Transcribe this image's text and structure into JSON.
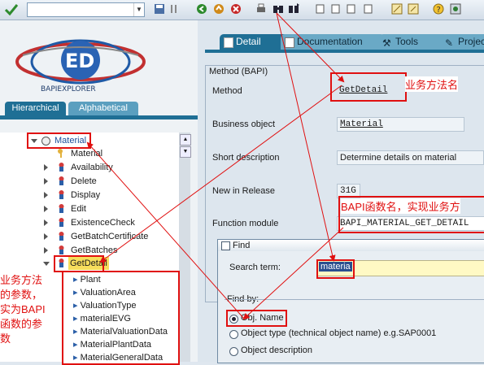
{
  "window": {
    "title": "BAPI Explorer"
  },
  "toolbar": {
    "command_value": "",
    "icons": [
      "ok-check",
      "save-disk",
      "back-arrow",
      "exit",
      "cancel",
      "print",
      "find",
      "find-next",
      "first-page",
      "prev-page",
      "next-page",
      "last-page",
      "new-session",
      "shortcut",
      "help",
      "customize"
    ]
  },
  "logo": {
    "text": "BAPI Explorer",
    "brand_letters": "ED"
  },
  "left_tabs": {
    "hierarchical": "Hierarchical",
    "alphabetical": "Alphabetical"
  },
  "tree": {
    "root": "Material",
    "children": [
      "Material",
      "Availability",
      "Delete",
      "Display",
      "Edit",
      "ExistenceCheck",
      "GetBatchCertificate",
      "GetBatches",
      "GetDetail"
    ],
    "getdetail_params": [
      "Plant",
      "ValuationArea",
      "ValuationType",
      "materialEVG",
      "MaterialValuationData",
      "MaterialPlantData",
      "MaterialGeneralData"
    ]
  },
  "right_tabs": {
    "detail": "Detail",
    "documentation": "Documentation",
    "tools": "Tools",
    "projects": "Projec"
  },
  "group": {
    "title": "Method (BAPI)"
  },
  "fields": {
    "method_label": "Method",
    "method_value": "GetDetail",
    "bo_label": "Business object",
    "bo_value": "Material",
    "short_label": "Short description",
    "short_value": "Determine details on material",
    "release_label": "New in Release",
    "release_value": "31G",
    "fm_label": "Function module",
    "fm_value": "BAPI_MATERIAL_GET_DETAIL"
  },
  "annotations": {
    "method_name": "业务方法名",
    "bapi_function": "BAPI函数名，实现业务方",
    "params": [
      "业务方法",
      "的参数，",
      "实为BAPI",
      "函数的参",
      "数"
    ]
  },
  "find_dialog": {
    "title": "Find",
    "search_label": "Search term:",
    "search_value": "materia",
    "find_by": "Find by:",
    "options": [
      "Obj. Name",
      "Object type (technical object name) e.g.SAP0001",
      "Object description"
    ],
    "selected": "Obj. Name"
  },
  "colors": {
    "accent": "#1f6f95",
    "annotation": "#e01010"
  }
}
